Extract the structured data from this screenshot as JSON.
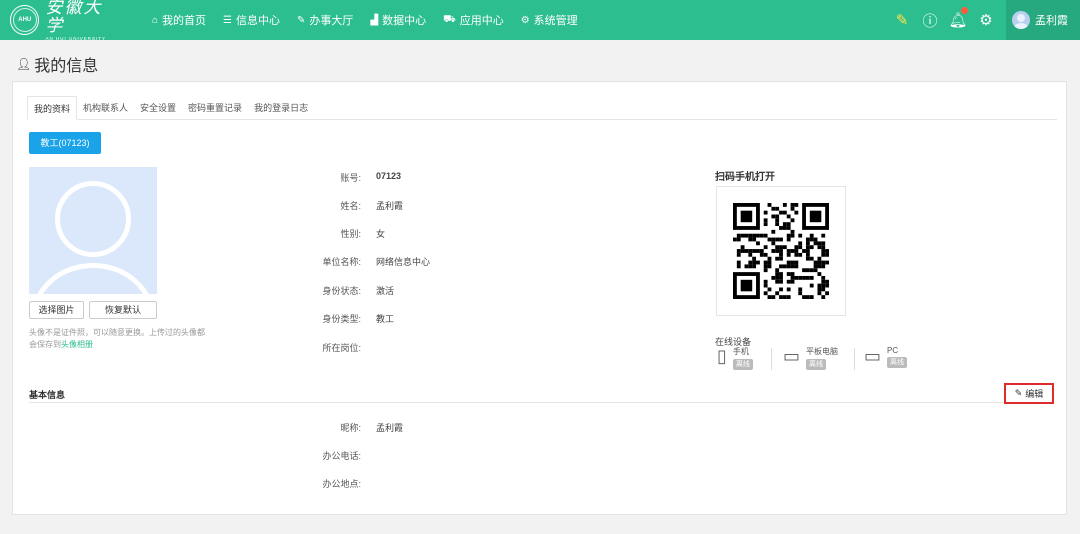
{
  "header": {
    "logo_cn": "安徽大学",
    "logo_en": "AN HUI UNIVERSITY",
    "nav": [
      {
        "icon": "home-icon",
        "glyph": "⌂",
        "label": "我的首页"
      },
      {
        "icon": "list-icon",
        "glyph": "☰",
        "label": "信息中心"
      },
      {
        "icon": "edit-icon",
        "glyph": "✎",
        "label": "办事大厅"
      },
      {
        "icon": "chart-icon",
        "glyph": "▟",
        "label": "数据中心"
      },
      {
        "icon": "cart-icon",
        "glyph": "⛟",
        "label": "应用中心"
      },
      {
        "icon": "gear-icon",
        "glyph": "⚙",
        "label": "系统管理"
      }
    ],
    "user_name": "孟利霞"
  },
  "page_title": "我的信息",
  "tabs": [
    "我的资料",
    "机构联系人",
    "安全设置",
    "密码重置记录",
    "我的登录日志"
  ],
  "role_button": "教工(07123)",
  "photo": {
    "select_label": "选择图片",
    "restore_label": "恢复默认",
    "hint_text": "头像不是证件照，可以随意更换。上传过的头像都会保存到",
    "hint_link": "头像相册"
  },
  "identity": {
    "account_label": "账号:",
    "account": "07123",
    "name_label": "姓名:",
    "name": "孟利霞",
    "gender_label": "性别:",
    "gender": "女",
    "unit_label": "单位名称:",
    "unit": "网络信息中心",
    "status_label": "身份状态:",
    "status": "激活",
    "type_label": "身份类型:",
    "type": "教工",
    "post_label": "所在岗位:",
    "post": ""
  },
  "qr": {
    "title": "扫码手机打开"
  },
  "devices": {
    "title": "在线设备",
    "items": [
      {
        "icon": "phone-icon",
        "name": "手机",
        "status": "离线"
      },
      {
        "icon": "tablet-icon",
        "name": "平板电脑",
        "status": "离线"
      },
      {
        "icon": "monitor-icon",
        "name": "PC",
        "status": "离线"
      }
    ]
  },
  "basic": {
    "title": "基本信息",
    "edit_label": "编辑",
    "nickname_label": "昵称:",
    "nickname": "孟利霞",
    "phone_label": "办公电话:",
    "phone": "",
    "address_label": "办公地点:",
    "address": ""
  },
  "colors": {
    "header": "#2dbe8f",
    "role_button": "#1aa3e8",
    "edit_highlight": "#e02b2b"
  }
}
